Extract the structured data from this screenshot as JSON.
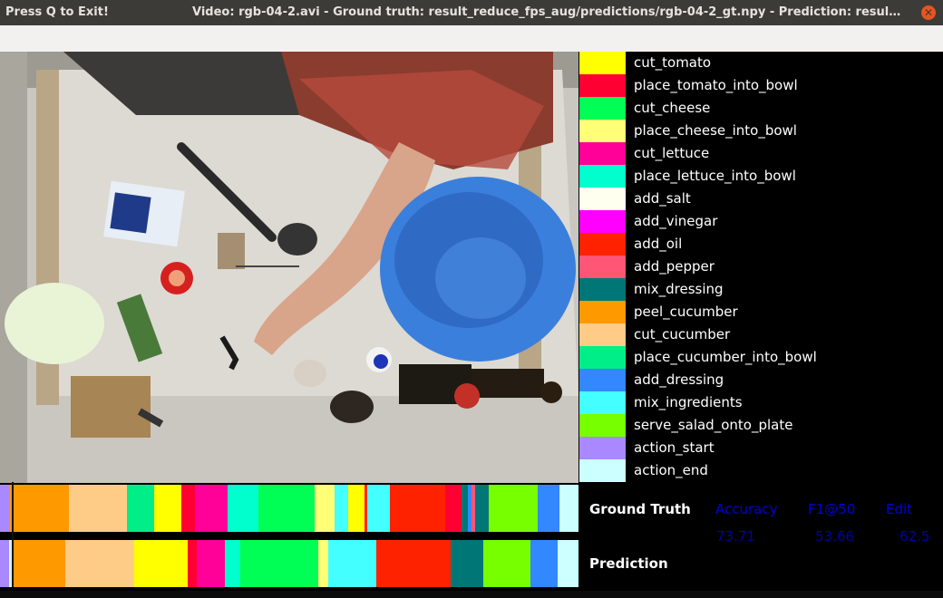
{
  "window": {
    "exit_hint": "Press Q to Exit!",
    "title": "Video: rgb-04-2.avi - Ground truth: result_reduce_fps_aug/predictions/rgb-04-2_gt.npy - Prediction: result_re...",
    "close_icon": "close-icon"
  },
  "legend": [
    {
      "label": "cut_tomato",
      "color": "#ffff00"
    },
    {
      "label": "place_tomato_into_bowl",
      "color": "#ff0033"
    },
    {
      "label": "cut_cheese",
      "color": "#00ff55"
    },
    {
      "label": "place_cheese_into_bowl",
      "color": "#ffff77"
    },
    {
      "label": "cut_lettuce",
      "color": "#ff0099"
    },
    {
      "label": "place_lettuce_into_bowl",
      "color": "#00ffcc"
    },
    {
      "label": "add_salt",
      "color": "#fffff0"
    },
    {
      "label": "add_vinegar",
      "color": "#ff00ff"
    },
    {
      "label": "add_oil",
      "color": "#ff2200"
    },
    {
      "label": "add_pepper",
      "color": "#ff5577"
    },
    {
      "label": "mix_dressing",
      "color": "#007777"
    },
    {
      "label": "peel_cucumber",
      "color": "#ff9900"
    },
    {
      "label": "cut_cucumber",
      "color": "#ffcc88"
    },
    {
      "label": "place_cucumber_into_bowl",
      "color": "#00ee88"
    },
    {
      "label": "add_dressing",
      "color": "#3388ff"
    },
    {
      "label": "mix_ingredients",
      "color": "#44ffff"
    },
    {
      "label": "serve_salad_onto_plate",
      "color": "#77ff00"
    },
    {
      "label": "action_start",
      "color": "#aa88ff"
    },
    {
      "label": "action_end",
      "color": "#ccffff"
    }
  ],
  "ground_truth_segments": [
    {
      "action": "action_start",
      "fraction": 0.017
    },
    {
      "action": "peel_cucumber",
      "fraction": 0.0975
    },
    {
      "action": "cut_cucumber",
      "fraction": 0.0975
    },
    {
      "action": "place_cucumber_into_bowl",
      "fraction": 0.045
    },
    {
      "action": "cut_tomato",
      "fraction": 0.0455
    },
    {
      "action": "place_tomato_into_bowl",
      "fraction": 0.0235
    },
    {
      "action": "cut_lettuce",
      "fraction": 0.0535
    },
    {
      "action": "place_lettuce_into_bowl",
      "fraction": 0.0525
    },
    {
      "action": "cut_cheese",
      "fraction": 0.0935
    },
    {
      "action": "place_cheese_into_bowl",
      "fraction": 0.0325
    },
    {
      "action": "mix_ingredients",
      "fraction": 0.0235
    },
    {
      "action": "cut_tomato",
      "fraction": 0.027
    },
    {
      "action": "add_oil",
      "fraction": 0.0045
    },
    {
      "action": "mix_ingredients",
      "fraction": 0.037
    },
    {
      "action": "add_oil",
      "fraction": 0.0935
    },
    {
      "action": "place_tomato_into_bowl",
      "fraction": 0.0275
    },
    {
      "action": "mix_dressing",
      "fraction": 0.0105
    },
    {
      "action": "add_dressing",
      "fraction": 0.005
    },
    {
      "action": "add_pepper",
      "fraction": 0.006
    },
    {
      "action": "mix_dressing",
      "fraction": 0.0225
    },
    {
      "action": "serve_salad_onto_plate",
      "fraction": 0.0825
    },
    {
      "action": "add_dressing",
      "fraction": 0.0355
    },
    {
      "action": "action_end",
      "fraction": 0.0325
    }
  ],
  "prediction_segments": [
    {
      "action": "action_start",
      "fraction": 0.015
    },
    {
      "action": "action_end",
      "fraction": 0.0075
    },
    {
      "action": "peel_cucumber",
      "fraction": 0.0905
    },
    {
      "action": "cut_cucumber",
      "fraction": 0.1195
    },
    {
      "action": "cut_tomato",
      "fraction": 0.092
    },
    {
      "action": "place_tomato_into_bowl",
      "fraction": 0.0155
    },
    {
      "action": "cut_lettuce",
      "fraction": 0.0485
    },
    {
      "action": "place_lettuce_into_bowl",
      "fraction": 0.0265
    },
    {
      "action": "cut_cheese",
      "fraction": 0.1345
    },
    {
      "action": "place_cheese_into_bowl",
      "fraction": 0.017
    },
    {
      "action": "mix_ingredients",
      "fraction": 0.0835
    },
    {
      "action": "add_oil",
      "fraction": 0.128
    },
    {
      "action": "mix_dressing",
      "fraction": 0.057
    },
    {
      "action": "serve_salad_onto_plate",
      "fraction": 0.0815
    },
    {
      "action": "add_dressing",
      "fraction": 0.0465
    },
    {
      "action": "action_end",
      "fraction": 0.0365
    }
  ],
  "playhead": {
    "fraction": 0.02
  },
  "metrics": {
    "ground_truth_label": "Ground Truth",
    "prediction_label": "Prediction",
    "headers": [
      "Accuracy",
      "F1@50",
      "Edit"
    ],
    "values": [
      "73.71",
      "53.66",
      "62.5"
    ]
  }
}
